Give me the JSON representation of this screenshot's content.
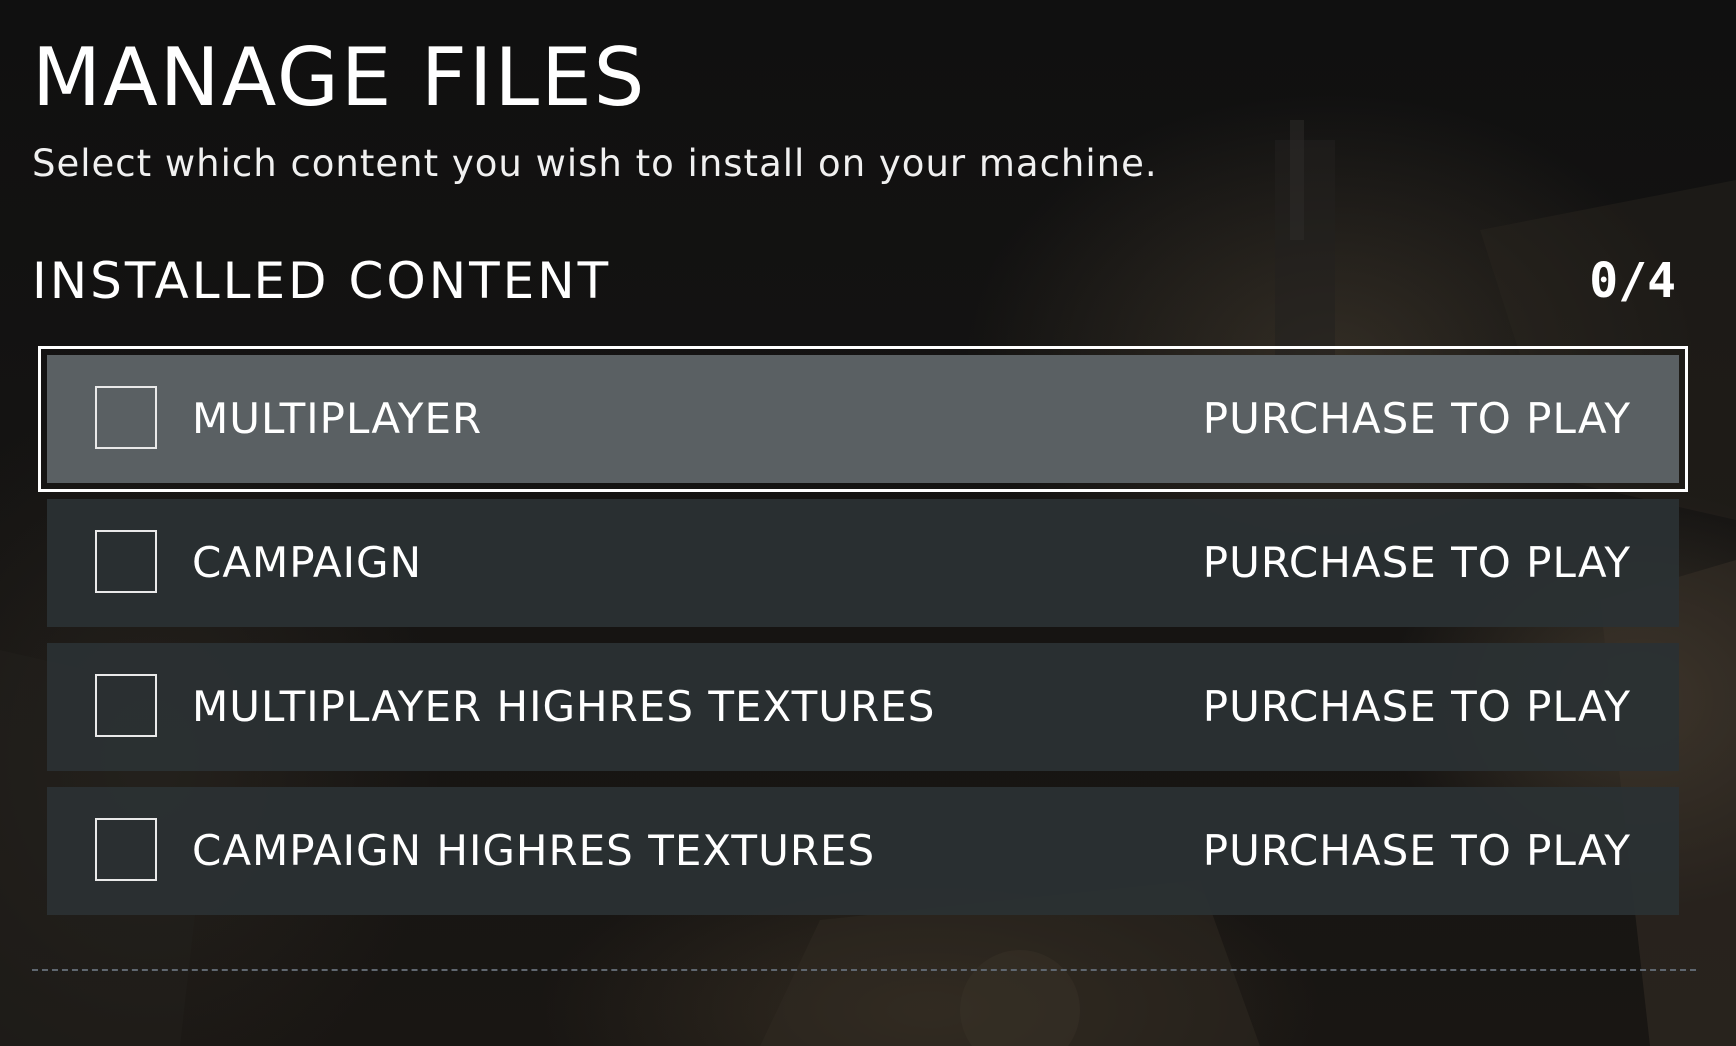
{
  "header": {
    "title": "MANAGE FILES",
    "subtitle": "Select which content you wish to install on your machine."
  },
  "installed_content": {
    "title": "INSTALLED CONTENT",
    "count": "0/4",
    "items": [
      {
        "label": "MULTIPLAYER",
        "status": "PURCHASE TO PLAY",
        "checked": false,
        "selected": true
      },
      {
        "label": "CAMPAIGN",
        "status": "PURCHASE TO PLAY",
        "checked": false,
        "selected": false
      },
      {
        "label": "MULTIPLAYER HIGHRES TEXTURES",
        "status": "PURCHASE TO PLAY",
        "checked": false,
        "selected": false
      },
      {
        "label": "CAMPAIGN HIGHRES TEXTURES",
        "status": "PURCHASE TO PLAY",
        "checked": false,
        "selected": false
      }
    ]
  },
  "colors": {
    "row_background": "#2b3133",
    "selected_row_background": "#5a6063",
    "selected_outline": "#ffffff",
    "text": "#ffffff",
    "divider": "#5f6770"
  }
}
